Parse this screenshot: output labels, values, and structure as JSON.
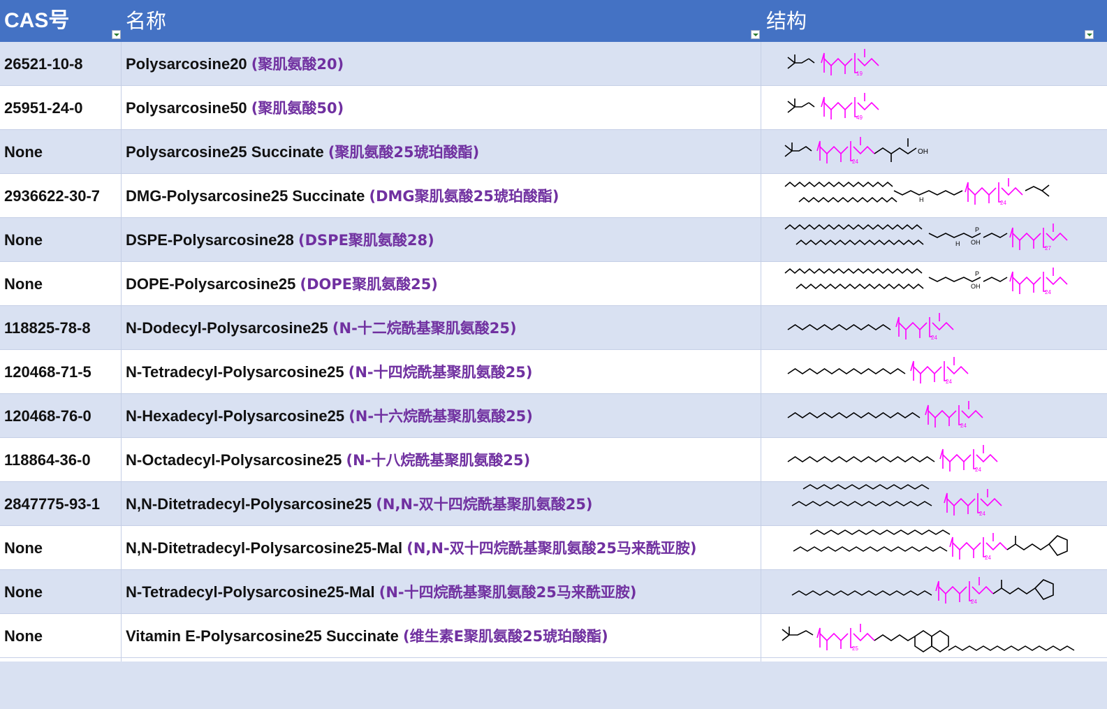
{
  "header": {
    "columns": [
      "CAS号",
      "名称",
      "结构"
    ]
  },
  "colors": {
    "header_bg": "#4472C4",
    "row_shade": "#D9E1F2",
    "cn_name": "#7030A0",
    "structure_peg": "#FF00FF",
    "structure_base": "#000000"
  },
  "rows": [
    {
      "cas": "26521-10-8",
      "name_en": "Polysarcosine20",
      "name_cn": "(聚肌氨酸20)",
      "n": "19",
      "type": "neo"
    },
    {
      "cas": "25951-24-0",
      "name_en": "Polysarcosine50",
      "name_cn": "(聚肌氨酸50)",
      "n": "49",
      "type": "neo"
    },
    {
      "cas": "None",
      "name_en": "Polysarcosine25 Succinate",
      "name_cn": "(聚肌氨酸25琥珀酸酯)",
      "n": "24",
      "type": "neo-succ",
      "label_oh": "OH"
    },
    {
      "cas": "2936622-30-7",
      "name_en": "DMG-Polysarcosine25 Succinate",
      "name_cn": "(DMG聚肌氨酸25琥珀酸酯)",
      "n": "24",
      "type": "dmg",
      "label_h": "H"
    },
    {
      "cas": "None",
      "name_en": "DSPE-Polysarcosine28",
      "name_cn": "(DSPE聚肌氨酸28)",
      "n": "27",
      "type": "dspe",
      "label_oh": "OH",
      "label_p": "P",
      "label_h": "H"
    },
    {
      "cas": "None",
      "name_en": "DOPE-Polysarcosine25",
      "name_cn": "(DOPE聚肌氨酸25)",
      "n": "24",
      "type": "dope",
      "label_oh": "OH",
      "label_p": "P"
    },
    {
      "cas": "118825-78-8",
      "name_en": "N-Dodecyl-Polysarcosine25",
      "name_cn": "(N-十二烷酰基聚肌氨酸25)",
      "n": "24",
      "type": "alkyl",
      "chain": 12
    },
    {
      "cas": "120468-71-5",
      "name_en": "N-Tetradecyl-Polysarcosine25",
      "name_cn": "(N-十四烷酰基聚肌氨酸25)",
      "n": "24",
      "type": "alkyl",
      "chain": 14
    },
    {
      "cas": "120468-76-0",
      "name_en": "N-Hexadecyl-Polysarcosine25",
      "name_cn": "(N-十六烷酰基聚肌氨酸25)",
      "n": "24",
      "type": "alkyl",
      "chain": 16
    },
    {
      "cas": "118864-36-0",
      "name_en": "N-Octadecyl-Polysarcosine25",
      "name_cn": "(N-十八烷酰基聚肌氨酸25)",
      "n": "24",
      "type": "alkyl",
      "chain": 18
    },
    {
      "cas": "2847775-93-1",
      "name_en": "N,N-Ditetradecyl-Polysarcosine25",
      "name_cn": "(N,N-双十四烷酰基聚肌氨酸25)",
      "n": "24",
      "type": "dialkyl"
    },
    {
      "cas": "None",
      "name_en": "N,N-Ditetradecyl-Polysarcosine25-Mal",
      "name_cn": "(N,N-双十四烷酰基聚肌氨酸25马来酰亚胺)",
      "n": "24",
      "type": "dialkyl-mal"
    },
    {
      "cas": "None",
      "name_en": "N-Tetradecyl-Polysarcosine25-Mal",
      "name_cn": "(N-十四烷酰基聚肌氨酸25马来酰亚胺)",
      "n": "24",
      "type": "alkyl-mal"
    },
    {
      "cas": "None",
      "name_en": "Vitamin E-Polysarcosine25 Succinate",
      "name_cn": "(维生素E聚肌氨酸25琥珀酸酯)",
      "n": "25",
      "type": "vite"
    }
  ]
}
